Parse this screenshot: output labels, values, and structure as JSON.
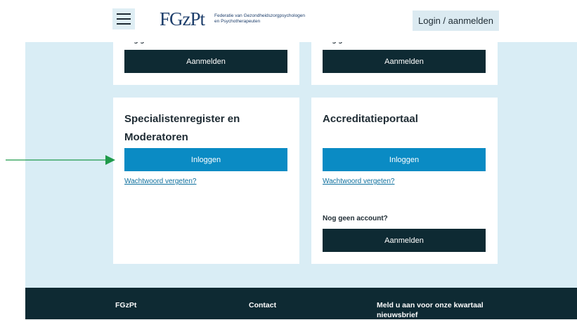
{
  "header": {
    "logo_mark": "FGzPt",
    "logo_text_line1": "Federatie van Gezondheidszorgpsychologen",
    "logo_text_line2": "en Psychotherapeuten",
    "login_label": "Login / aanmelden"
  },
  "top_left_card": {
    "no_account_label": "Nog geen account?",
    "register_label": "Aanmelden"
  },
  "top_right_card": {
    "no_account_label": "Nog geen account?",
    "register_label": "Aanmelden"
  },
  "specialist_card": {
    "title": "Specialistenregister en Moderatoren",
    "login_label": "Inloggen",
    "forgot_label": "Wachtwoord vergeten?"
  },
  "accreditation_card": {
    "title": "Accreditatieportaal",
    "login_label": "Inloggen",
    "forgot_label": "Wachtwoord vergeten?",
    "no_account_label": "Nog geen account?",
    "register_label": "Aanmelden"
  },
  "footer": {
    "col1": "FGzPt",
    "col2": "Contact",
    "col3": "Meld u aan voor onze kwartaal nieuwsbrief"
  },
  "colors": {
    "page_bg": "#d9edf5",
    "dark_button": "#0e2a33",
    "blue_button": "#0a8bc4",
    "link": "#0d6f9d",
    "arrow": "#1f9a4a"
  }
}
